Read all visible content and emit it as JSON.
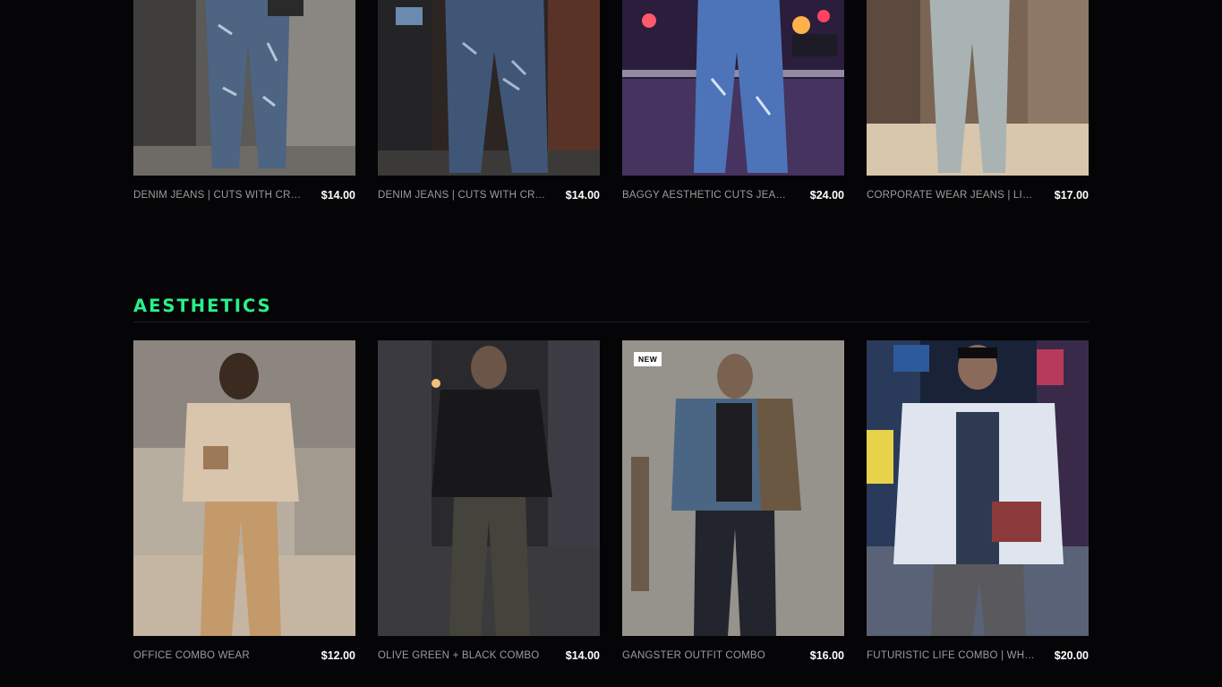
{
  "top_products": [
    {
      "name": "DENIM JEANS | CUTS WITH CREASES",
      "price": "$14.00"
    },
    {
      "name": "DENIM JEANS | CUTS WITH CREASES",
      "price": "$14.00"
    },
    {
      "name": "BAGGY AESTHETIC CUTS JEANS | BLUE",
      "price": "$24.00"
    },
    {
      "name": "CORPORATE WEAR JEANS | LIGHT",
      "price": "$17.00"
    }
  ],
  "aesthetics": {
    "title": "AESTHETICS",
    "products": [
      {
        "name": "OFFICE COMBO WEAR",
        "price": "$12.00"
      },
      {
        "name": "OLIVE GREEN + BLACK COMBO",
        "price": "$14.00"
      },
      {
        "name": "GANGSTER OUTFIT COMBO",
        "price": "$16.00",
        "badge": "NEW"
      },
      {
        "name": "FUTURISTIC LIFE COMBO | WHITE",
        "price": "$20.00"
      }
    ]
  },
  "colors": {
    "accent": "#2bef8a",
    "background": "#050507",
    "price": "#ffffff",
    "name": "#9c9c9c"
  }
}
